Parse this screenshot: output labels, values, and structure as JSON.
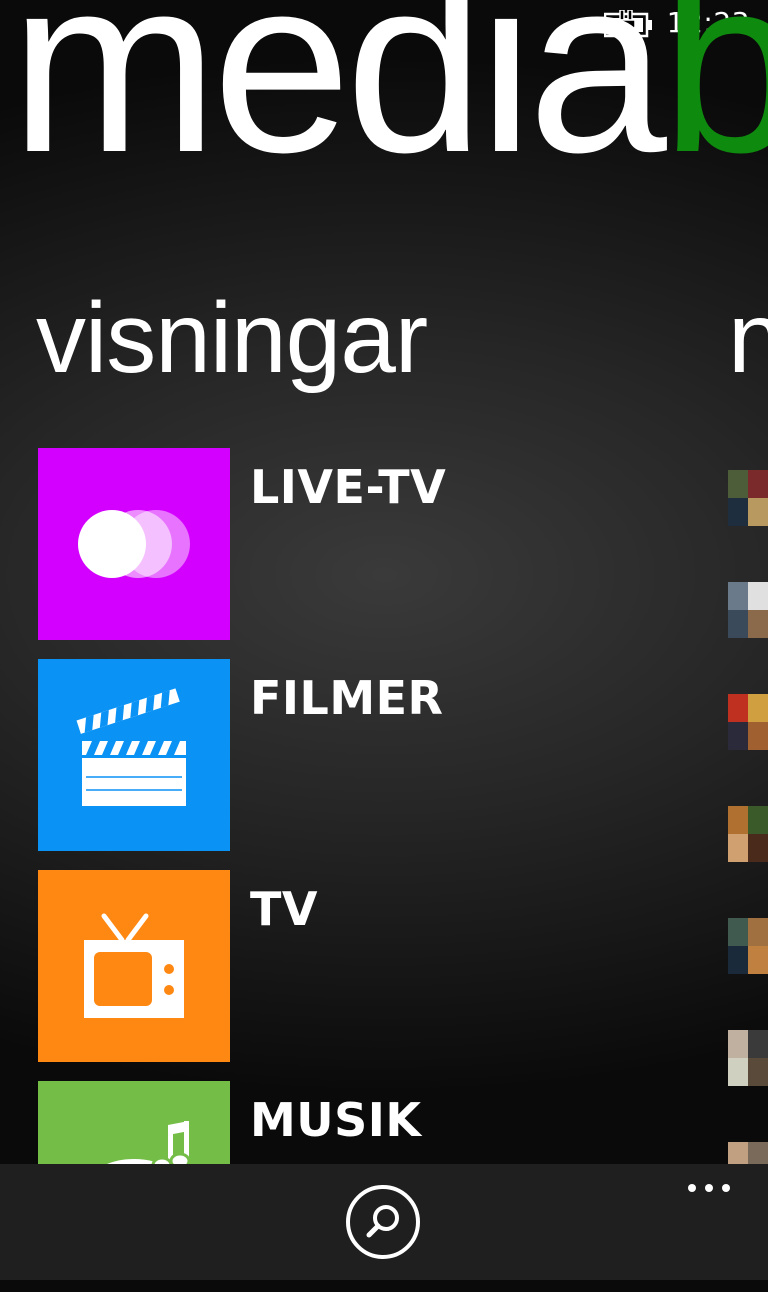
{
  "status_bar": {
    "time": "12:23",
    "battery_icon": "battery-charging-icon"
  },
  "app_title": {
    "part1": "media",
    "part2": "b",
    "accent_color": "#0e8a0e"
  },
  "pivot": {
    "current": "visningar",
    "next_peek": "n"
  },
  "menu": {
    "items": [
      {
        "label": "LIVE-TV",
        "icon": "live-tv-circles-icon",
        "color": "#d400ff"
      },
      {
        "label": "FILMER",
        "icon": "clapperboard-icon",
        "color": "#0a92f5"
      },
      {
        "label": "TV",
        "icon": "television-icon",
        "color": "#ff8812"
      },
      {
        "label": "MUSIK",
        "icon": "music-note-icon",
        "color": "#74be48"
      }
    ]
  },
  "app_bar": {
    "search_icon": "search-icon",
    "more_icon": "more-ellipsis-icon"
  }
}
